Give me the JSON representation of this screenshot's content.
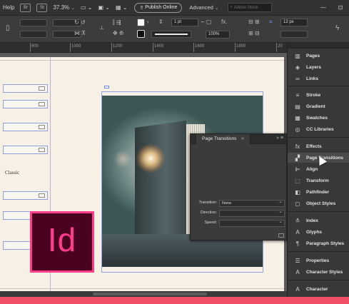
{
  "menubar": {
    "help": "Help",
    "br_label": "Br",
    "st_label": "St",
    "zoom": "37.3%",
    "publish": "Publish Online",
    "workspace": "Advanced",
    "stock_placeholder": "Adobe Stock",
    "win_min": "—",
    "win_max": "⊡"
  },
  "control": {
    "stroke_weight": "1 pt",
    "opacity": "100%",
    "size_field": "12 px",
    "fx": "fx."
  },
  "ruler": {
    "ticks": [
      "800",
      "1000",
      "1200",
      "1400",
      "1600",
      "1800",
      "20"
    ]
  },
  "document": {
    "text_sample": "Classic"
  },
  "page_transitions": {
    "tab": "Page Transitions",
    "close": "✕",
    "menu": "»  ≡",
    "transition_label": "Transition:",
    "transition_value": "None",
    "direction_label": "Direction:",
    "direction_value": "",
    "speed_label": "Speed:",
    "speed_value": ""
  },
  "dock": {
    "items": [
      {
        "label": "Pages",
        "icon": "▥"
      },
      {
        "label": "Layers",
        "icon": "◈"
      },
      {
        "label": "Links",
        "icon": "∞"
      },
      {
        "label": "Stroke",
        "icon": "≡"
      },
      {
        "label": "Gradient",
        "icon": "▤"
      },
      {
        "label": "Swatches",
        "icon": "▦"
      },
      {
        "label": "CC Libraries",
        "icon": "◎"
      },
      {
        "label": "Effects",
        "icon": "fx"
      },
      {
        "label": "Page Transitions",
        "icon": "▞"
      },
      {
        "label": "Align",
        "icon": "⊫"
      },
      {
        "label": "Transform",
        "icon": "⬚"
      },
      {
        "label": "Pathfinder",
        "icon": "◧"
      },
      {
        "label": "Object Styles",
        "icon": "◻"
      },
      {
        "label": "Index",
        "icon": "≛"
      },
      {
        "label": "Glyphs",
        "icon": "A"
      },
      {
        "label": "Paragraph Styles",
        "icon": "¶"
      },
      {
        "label": "Properties",
        "icon": "☰"
      },
      {
        "label": "Character Styles",
        "icon": "A"
      },
      {
        "label": "Character",
        "icon": "A"
      }
    ]
  },
  "logo": {
    "text": "Id"
  }
}
